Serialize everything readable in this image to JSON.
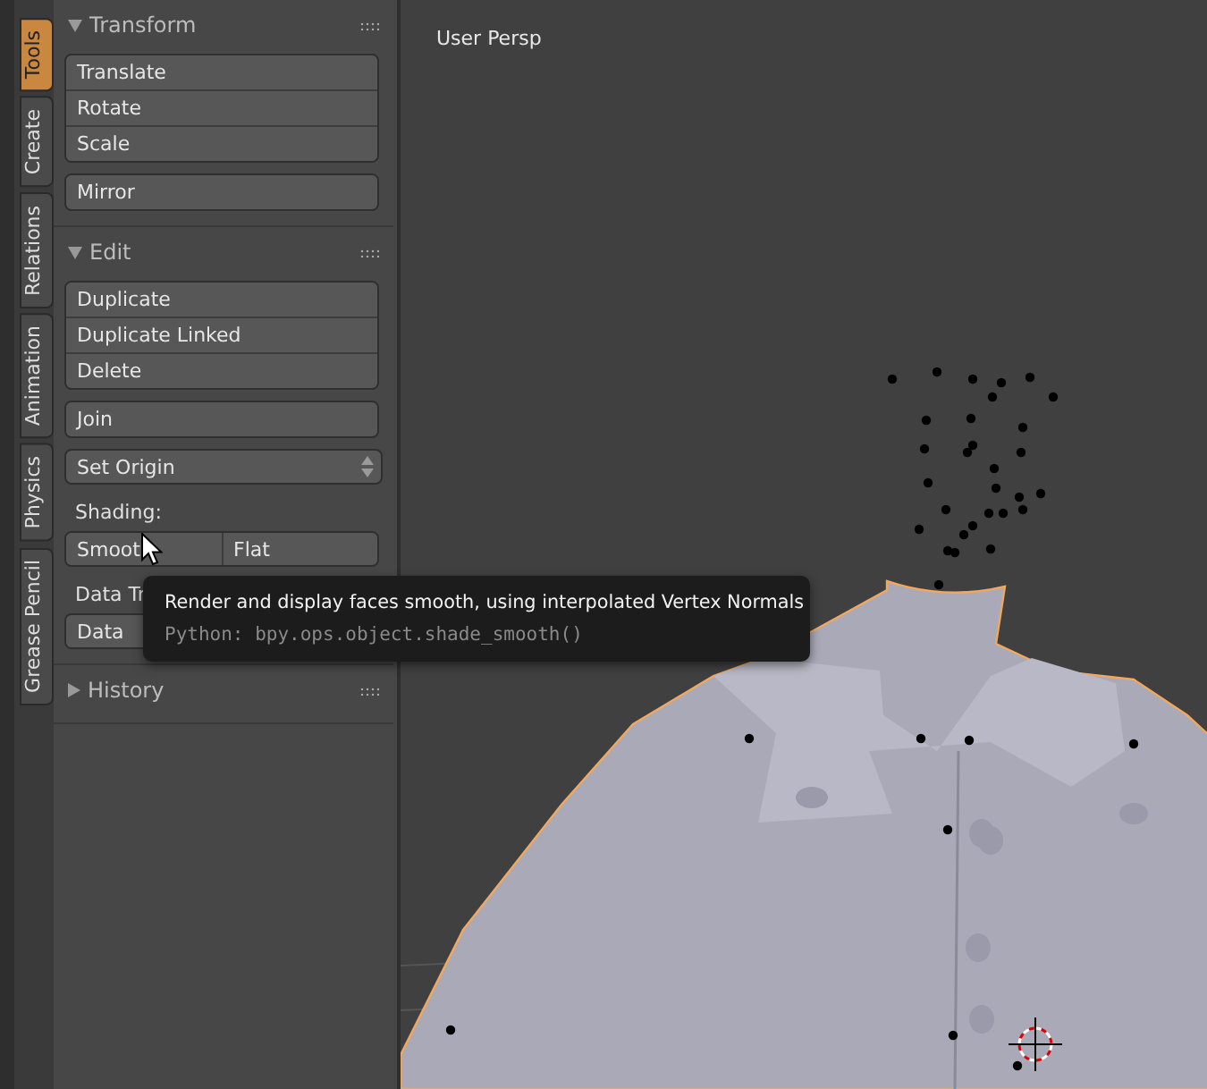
{
  "tabs": [
    {
      "label": "Tools",
      "selected": true
    },
    {
      "label": "Create",
      "selected": false
    },
    {
      "label": "Relations",
      "selected": false
    },
    {
      "label": "Animation",
      "selected": false
    },
    {
      "label": "Physics",
      "selected": false
    },
    {
      "label": "Grease Pencil",
      "selected": false
    }
  ],
  "panels": [
    {
      "title": "Transform",
      "expanded": true,
      "items": [
        {
          "kind": "buttons",
          "labels": [
            "Translate",
            "Rotate",
            "Scale"
          ]
        },
        {
          "kind": "buttons",
          "labels": [
            "Mirror"
          ]
        }
      ]
    },
    {
      "title": "Edit",
      "expanded": true,
      "items": [
        {
          "kind": "buttons",
          "labels": [
            "Duplicate",
            "Duplicate Linked",
            "Delete"
          ]
        },
        {
          "kind": "buttons",
          "labels": [
            "Join"
          ]
        },
        {
          "kind": "dropdown",
          "label": "Set Origin"
        },
        {
          "kind": "label",
          "text": "Shading:"
        },
        {
          "kind": "row",
          "labels": [
            "Smoot",
            "Flat"
          ]
        },
        {
          "kind": "label",
          "text": "Data Tr"
        },
        {
          "kind": "row",
          "labels": [
            "Data"
          ]
        }
      ]
    },
    {
      "title": "History",
      "expanded": false
    }
  ],
  "tooltip": {
    "text": "Render and display faces smooth, using interpolated Vertex Normals",
    "python": "Python: bpy.ops.object.shade_smooth()"
  },
  "viewport": {
    "label": "User Persp"
  }
}
